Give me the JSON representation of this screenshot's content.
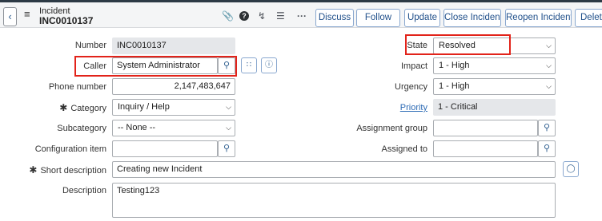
{
  "header": {
    "title": "Incident",
    "number": "INC0010137",
    "icons": [
      "paperclip-icon",
      "help-icon",
      "activity-icon",
      "settings-sliders-icon",
      "more-icon"
    ],
    "buttons": [
      "Discuss",
      "Follow",
      "Update",
      "Close Incident",
      "Reopen Incident",
      "Delete"
    ]
  },
  "form": {
    "number": {
      "label": "Number",
      "value": "INC0010137"
    },
    "caller": {
      "label": "Caller",
      "value": "System Administrator"
    },
    "phone": {
      "label": "Phone number",
      "value": "2,147,483,647"
    },
    "category": {
      "label": "Category",
      "value": "Inquiry / Help"
    },
    "subcategory": {
      "label": "Subcategory",
      "value": "-- None --"
    },
    "config_item": {
      "label": "Configuration item",
      "value": ""
    },
    "short_description": {
      "label": "Short description",
      "value": "Creating new Incident"
    },
    "description": {
      "label": "Description",
      "value": "Testing123"
    },
    "state": {
      "label": "State",
      "value": "Resolved"
    },
    "impact": {
      "label": "Impact",
      "value": "1 - High"
    },
    "urgency": {
      "label": "Urgency",
      "value": "1 - High"
    },
    "priority": {
      "label": "Priority",
      "value": "1 - Critical"
    },
    "assignment_group": {
      "label": "Assignment group",
      "value": ""
    },
    "assigned_to": {
      "label": "Assigned to",
      "value": ""
    }
  },
  "highlight_color": "#e2231a"
}
